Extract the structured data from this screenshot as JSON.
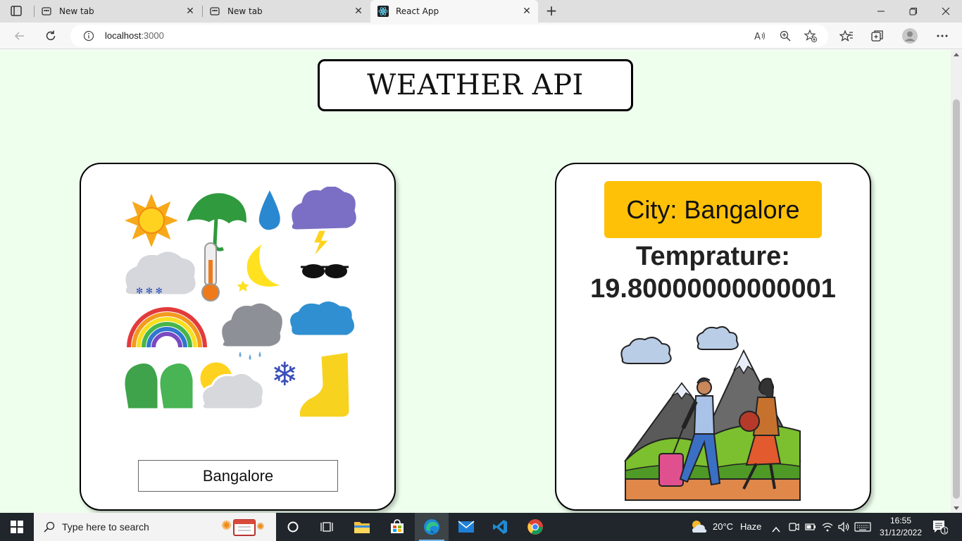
{
  "browser": {
    "tabs": [
      {
        "title": "New tab",
        "active": false
      },
      {
        "title": "New tab",
        "active": false
      },
      {
        "title": "React App",
        "active": true
      }
    ],
    "address": {
      "host": "localhost",
      "port": ":3000"
    }
  },
  "page": {
    "title": "WEATHER API",
    "search": {
      "value": "Bangalore"
    },
    "result": {
      "city_text": "City: Bangalore",
      "temp_label": "Temprature:",
      "temp_value": "19.80000000000001"
    }
  },
  "taskbar": {
    "search_placeholder": "Type here to search",
    "weather_temp": "20°C",
    "weather_desc": "Haze",
    "time": "16:55",
    "date": "31/12/2022",
    "notification_count": "1"
  },
  "colors": {
    "page_bg": "#eeffee",
    "city_badge": "#ffc107",
    "taskbar": "#20262b"
  }
}
